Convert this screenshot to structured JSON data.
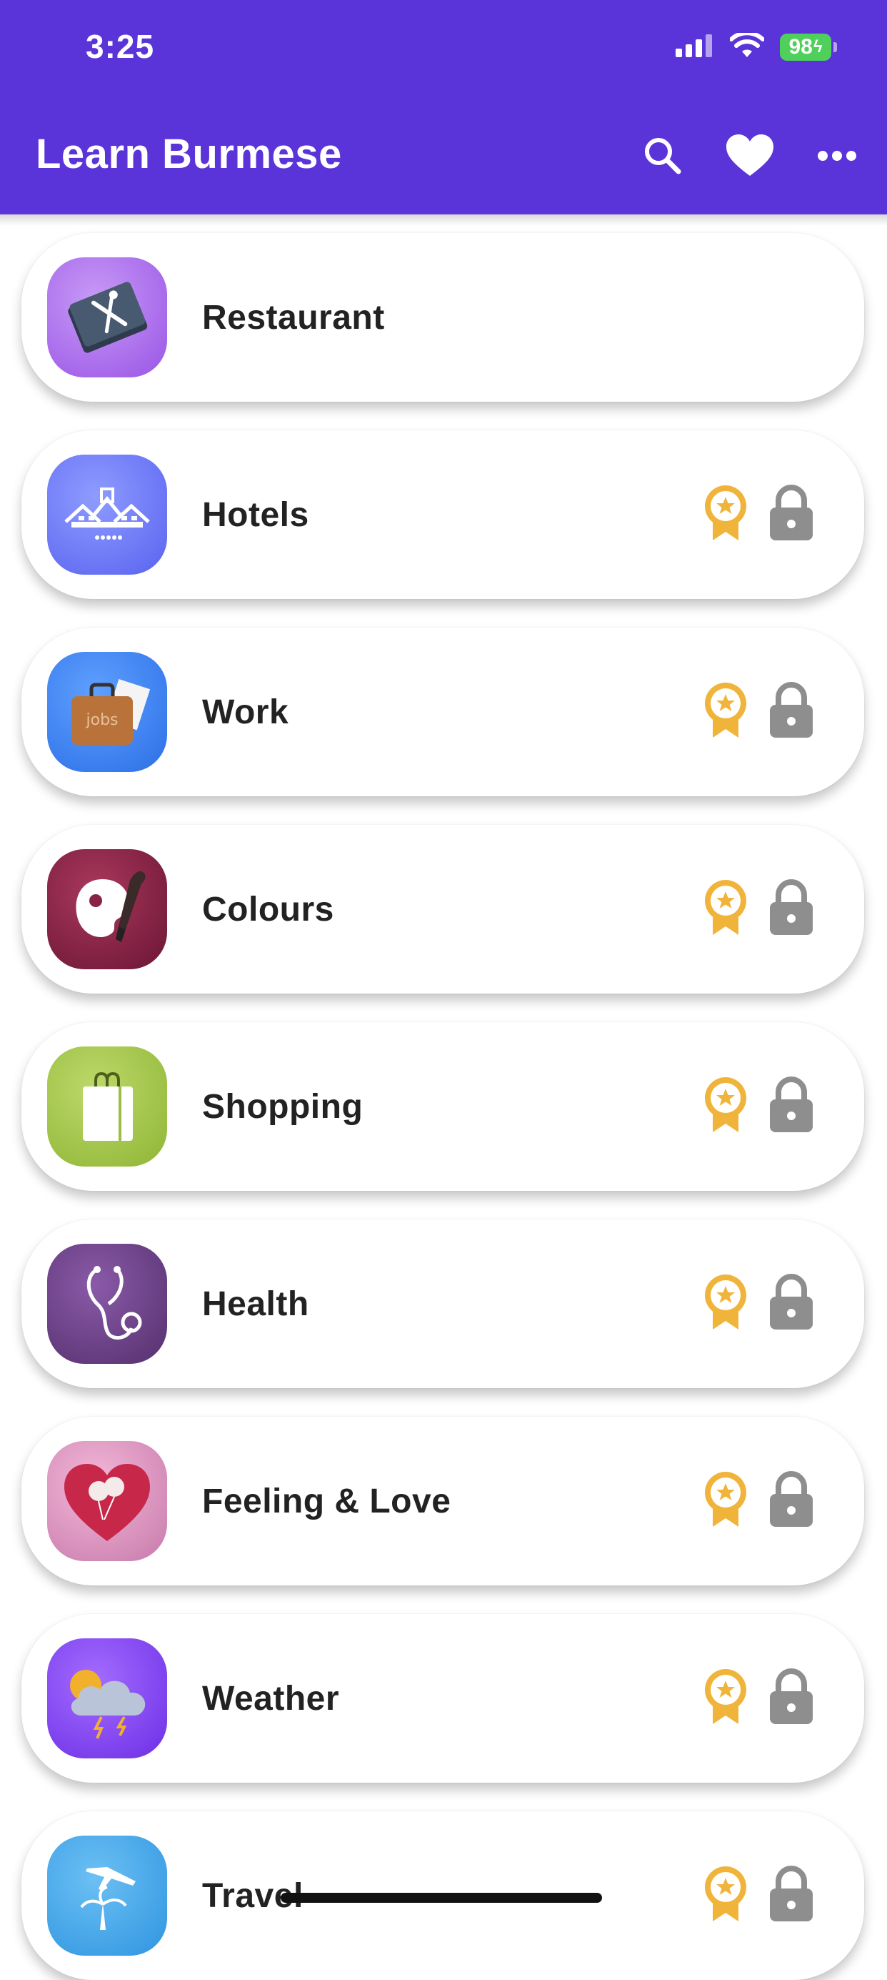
{
  "status_bar": {
    "time": "3:25",
    "battery": "98"
  },
  "app_bar": {
    "title": "Learn Burmese",
    "actions": [
      "search-icon",
      "heart-icon",
      "more-icon"
    ]
  },
  "colors": {
    "primary": "#5b34d9",
    "badge": "#f0b43a",
    "lock": "#8e8e8e",
    "battery": "#4ed05b"
  },
  "categories": [
    {
      "label": "Restaurant",
      "icon": "restaurant-menu-icon",
      "locked": false
    },
    {
      "label": "Hotels",
      "icon": "hotel-icon",
      "locked": true
    },
    {
      "label": "Work",
      "icon": "briefcase-icon",
      "locked": true
    },
    {
      "label": "Colours",
      "icon": "paint-palette-icon",
      "locked": true
    },
    {
      "label": "Shopping",
      "icon": "shopping-bag-icon",
      "locked": true
    },
    {
      "label": "Health",
      "icon": "stethoscope-icon",
      "locked": true
    },
    {
      "label": "Feeling & Love",
      "icon": "heart-balloons-icon",
      "locked": true
    },
    {
      "label": "Weather",
      "icon": "weather-cloud-icon",
      "locked": true
    },
    {
      "label": "Travel",
      "icon": "travel-plane-icon",
      "locked": true
    }
  ]
}
